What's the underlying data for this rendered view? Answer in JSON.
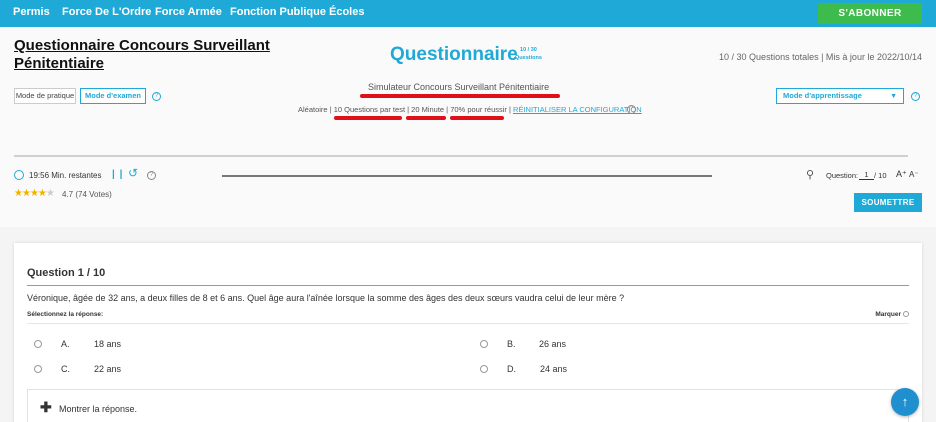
{
  "nav": {
    "items": [
      "Permis",
      "Force De L'Ordre",
      "Force Armée",
      "Fonction Publique",
      "Écoles"
    ],
    "subscribe_label": "S'ABONNER"
  },
  "header": {
    "page_title": "Questionnaire Concours Surveillant Pénitentiaire",
    "quiz_title": "Questionnaire",
    "quiz_count": "10 / 30",
    "quiz_count_unit": "Questions",
    "meta": "10 / 30 Questions totales | Mis à jour le 2022/10/14",
    "simulator_title": "Simulateur Concours Surveillant Pénitentiaire",
    "mode_practice": "Mode de pratique",
    "mode_exam": "Mode d'examen",
    "learning_mode": "Mode d'apprentissage",
    "config": {
      "random": "Aléatoire",
      "questions_per_test": "10 Questions par test",
      "minutes": "20 Minute",
      "pass_rate": "70% pour réussir",
      "reset": "RÉINITIALISER LA CONFIGURATION"
    }
  },
  "toolbar": {
    "timer": "19:56 Min. restantes",
    "question_label": "Question:",
    "question_current": "1",
    "question_total": "/ 10",
    "font_up": "A⁺",
    "font_down": "A⁻"
  },
  "rating": {
    "score": 4.7,
    "text": "4.7",
    "votes": "(74 Votes)"
  },
  "submit_label": "SOUMETTRE",
  "question": {
    "heading": "Question 1 / 10",
    "text": "Véronique, âgée de 32 ans, a deux filles de 8 et 6 ans. Quel âge aura l'aînée lorsque la somme des âges des deux sœurs vaudra celui de leur mère ?",
    "select_label": "Sélectionnez la réponse:",
    "mark_label": "Marquer",
    "options": [
      {
        "letter": "A.",
        "value": "18 ans"
      },
      {
        "letter": "B.",
        "value": "26 ans"
      },
      {
        "letter": "C.",
        "value": "22 ans"
      },
      {
        "letter": "D.",
        "value": "24 ans"
      }
    ],
    "reveal_label": "Montrer la réponse."
  },
  "icons": {
    "timer": "clock-icon",
    "pause": "pause-icon",
    "restart": "restart-icon",
    "help": "help-icon",
    "search": "search-icon",
    "scroll_top": "arrow-up-icon"
  },
  "colors": {
    "brand": "#1fa9d6",
    "subscribe": "#3dbb4c",
    "highlight": "#e0101a",
    "star": "#f3b200"
  }
}
